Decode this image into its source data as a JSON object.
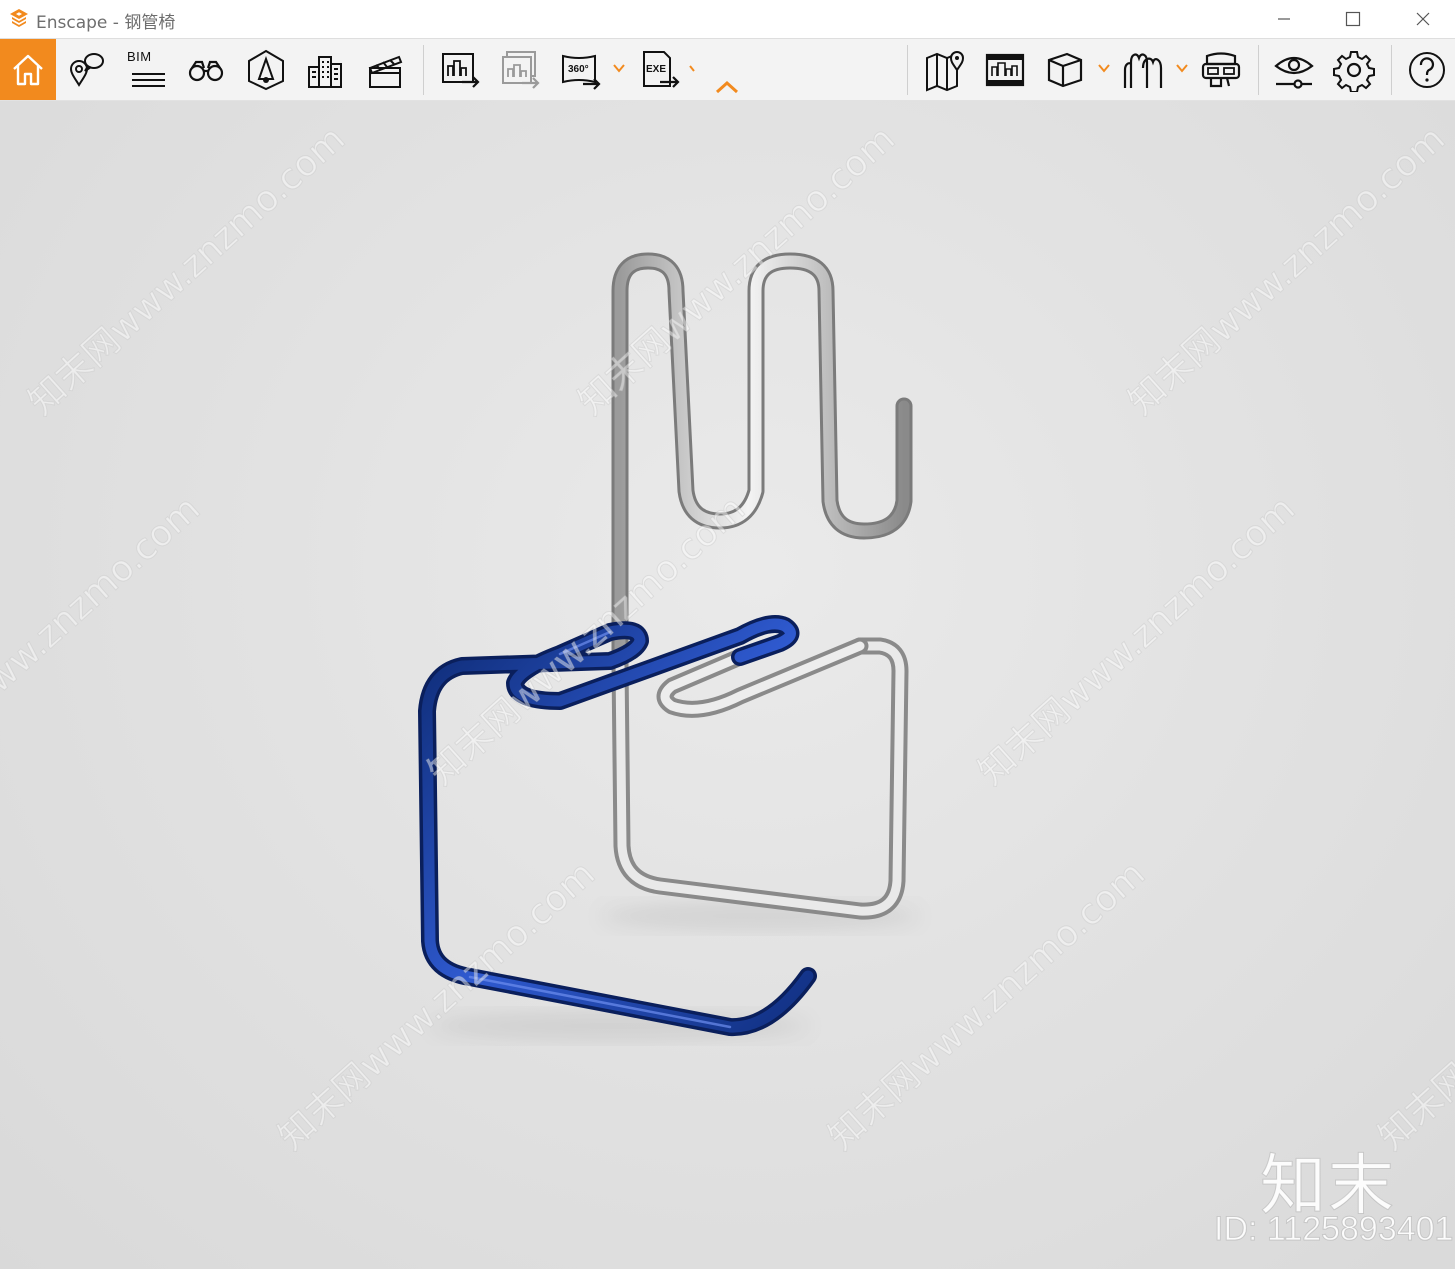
{
  "window": {
    "title": "Enscape - 钢管椅",
    "controls": [
      "minimize",
      "maximize",
      "close"
    ]
  },
  "toolbar": {
    "accent_color": "#f28a1e",
    "bim_label": "BIM",
    "btn_360_label": "360°",
    "btn_exe_label": "EXE",
    "items": [
      {
        "name": "home",
        "icon": "home-icon",
        "active": true
      },
      {
        "name": "views",
        "icon": "location-bubble-icon"
      },
      {
        "name": "bim",
        "icon": "bim-lines-icon"
      },
      {
        "name": "binoculars",
        "icon": "binoculars-icon"
      },
      {
        "name": "sound",
        "icon": "speaker-icon"
      },
      {
        "name": "assets",
        "icon": "buildings-icon"
      },
      {
        "name": "video-editor",
        "icon": "clapperboard-icon"
      },
      {
        "name": "screenshot",
        "icon": "screenshot-export-icon"
      },
      {
        "name": "batch-render",
        "icon": "batch-render-icon"
      },
      {
        "name": "panorama-360",
        "icon": "panorama-360-icon"
      },
      {
        "name": "export-exe",
        "icon": "exe-export-icon"
      },
      {
        "name": "collapse-toolbar",
        "icon": "chevron-up-icon"
      },
      {
        "name": "map",
        "icon": "map-pin-icon"
      },
      {
        "name": "gallery",
        "icon": "gallery-icon"
      },
      {
        "name": "materials",
        "icon": "cube-icon"
      },
      {
        "name": "vr",
        "icon": "vr-headset-icon"
      },
      {
        "name": "asset-library",
        "icon": "forest-icon"
      },
      {
        "name": "visual-settings",
        "icon": "eye-slider-icon"
      },
      {
        "name": "settings",
        "icon": "gear-icon"
      },
      {
        "name": "help",
        "icon": "help-icon"
      }
    ]
  },
  "viewport": {
    "watermark_text": "知末网www.znzmo.com",
    "brand_text": "知末",
    "id_text": "ID: 1125893401",
    "tube_colors": {
      "blue": "#1f3f9a",
      "silver": "#c9c9c9"
    }
  }
}
